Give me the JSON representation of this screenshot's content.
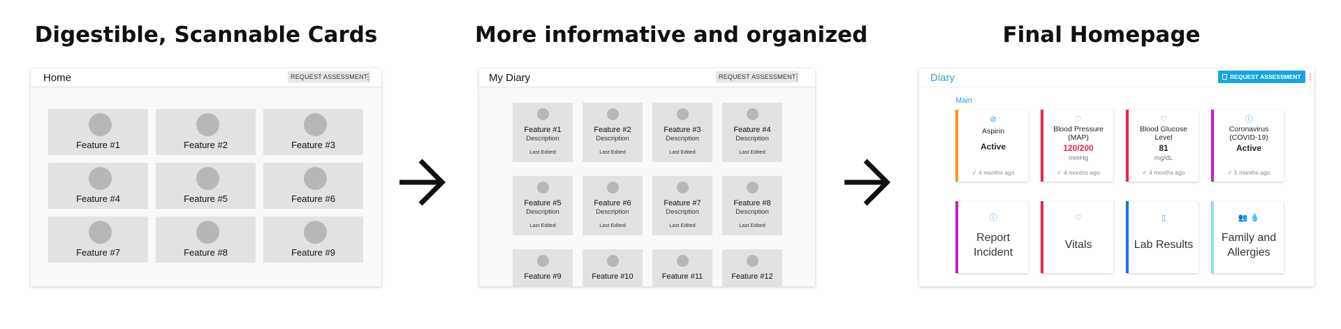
{
  "headings": {
    "left": "Digestible, Scannable Cards",
    "middle": "More informative and organized",
    "right": "Final Homepage"
  },
  "panel1": {
    "title": "Home",
    "request_label": "REQUEST ASSESSMENT",
    "menu_glyph": "⋮",
    "cards": [
      "Feature #1",
      "Feature #2",
      "Feature #3",
      "Feature #4",
      "Feature #5",
      "Feature #6",
      "Feature #7",
      "Feature #8",
      "Feature #9"
    ]
  },
  "panel2": {
    "title": "My Diary",
    "request_label": "REQUEST ASSESSMENT",
    "menu_glyph": "⋮",
    "cards": [
      {
        "name": "Feature #1",
        "desc": "Description",
        "edited": "Last Edited"
      },
      {
        "name": "Feature #2",
        "desc": "Description",
        "edited": "Last Edited"
      },
      {
        "name": "Feature #3",
        "desc": "Description",
        "edited": "Last Edited"
      },
      {
        "name": "Feature #4",
        "desc": "Description",
        "edited": "Last Edited"
      },
      {
        "name": "Feature #5",
        "desc": "Description",
        "edited": "Last Edited"
      },
      {
        "name": "Feature #6",
        "desc": "Description",
        "edited": "Last Edited"
      },
      {
        "name": "Feature #7",
        "desc": "Description",
        "edited": "Last Edited"
      },
      {
        "name": "Feature #8",
        "desc": "Description",
        "edited": "Last Edited"
      },
      {
        "name": "Feature #9",
        "desc": "",
        "edited": ""
      },
      {
        "name": "Feature #10",
        "desc": "",
        "edited": ""
      },
      {
        "name": "Feature #11",
        "desc": "",
        "edited": ""
      },
      {
        "name": "Feature #12",
        "desc": "",
        "edited": ""
      }
    ]
  },
  "panel3": {
    "title": "Diary",
    "request_label": "REQUEST ASSESSMENT",
    "menu_glyph": "⋮",
    "section_label": "Main",
    "status_cards": [
      {
        "name": "Aspirin",
        "value": "Active",
        "unit": "",
        "ago": "✓ 4 months ago",
        "icon": "pill-icon",
        "glyph": "⊘",
        "accent": "#f0961e",
        "value_color": "#222222"
      },
      {
        "name": "Blood Pressure (MAP)",
        "value": "120/200",
        "unit": "mmHg",
        "ago": "✓ 4 months ago",
        "icon": "heart-icon",
        "glyph": "♡",
        "accent": "#e8254f",
        "value_color": "#e8254f"
      },
      {
        "name": "Blood Glucose Level",
        "value": "81",
        "unit": "mg/dL",
        "ago": "✓ 4 months ago",
        "icon": "heart-icon",
        "glyph": "♡",
        "accent": "#e8254f",
        "value_color": "#222222"
      },
      {
        "name": "Coronavirus (COVID-19)",
        "value": "Active",
        "unit": "",
        "ago": "✓ 5 months ago",
        "icon": "info-icon",
        "glyph": "ⓘ",
        "accent": "#c41ec4",
        "value_color": "#222222"
      }
    ],
    "section_cards": [
      {
        "label": "Report Incident",
        "icon": "info-icon",
        "glyph": "ⓘ",
        "accent": "#c41ec4"
      },
      {
        "label": "Vitals",
        "icon": "heart-icon",
        "glyph": "♡",
        "accent": "#e8254f"
      },
      {
        "label": "Lab Results",
        "icon": "clipboard-icon",
        "glyph": "▯",
        "accent": "#1e6ef0"
      },
      {
        "label": "Family and Allergies",
        "icon": "people-drop-icon",
        "glyph": "👥 💧",
        "accent": "#8edcf5"
      }
    ]
  }
}
